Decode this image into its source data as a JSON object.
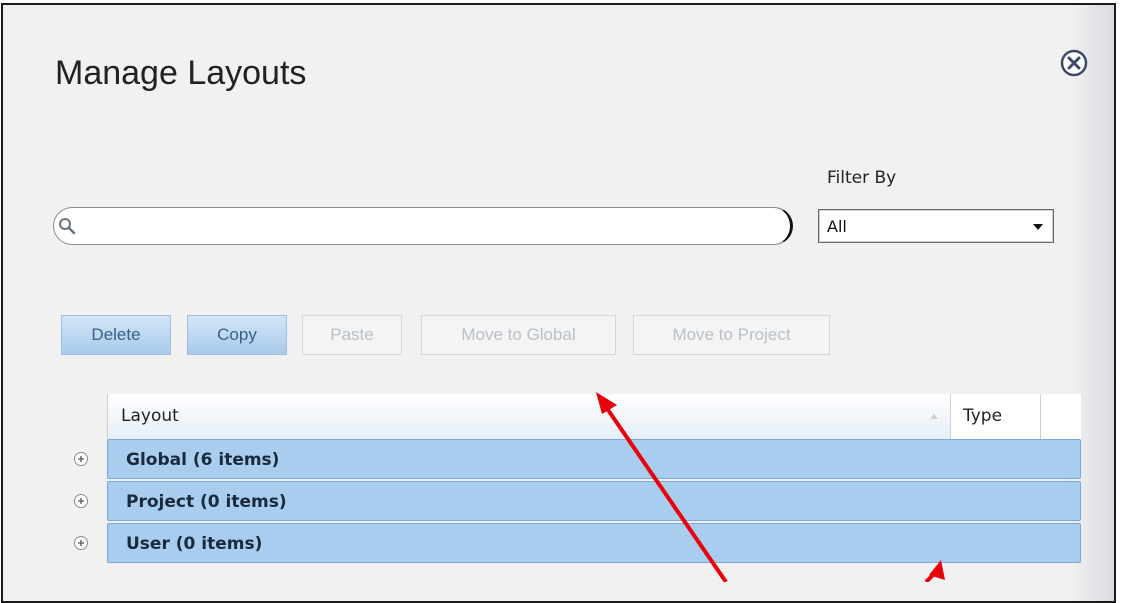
{
  "dialog": {
    "title": "Manage Layouts"
  },
  "filter": {
    "label": "Filter By",
    "selected": "All"
  },
  "search": {
    "value": "",
    "placeholder": ""
  },
  "toolbar": {
    "delete_label": "Delete",
    "copy_label": "Copy",
    "paste_label": "Paste",
    "move_global_label": "Move to Global",
    "move_project_label": "Move to Project"
  },
  "grid": {
    "columns": [
      "Layout",
      "Type"
    ],
    "groups": [
      {
        "label": "Global (6 items)"
      },
      {
        "label": "Project (0 items)"
      },
      {
        "label": "User (0 items)"
      }
    ]
  },
  "icons": {
    "close": "close-circle-icon",
    "search": "search-icon",
    "expand": "plus-circle-icon"
  },
  "colors": {
    "annotation_arrow": "#e8000b",
    "group_bar": "#a9cdef",
    "button_active": "#a8c9ea"
  }
}
